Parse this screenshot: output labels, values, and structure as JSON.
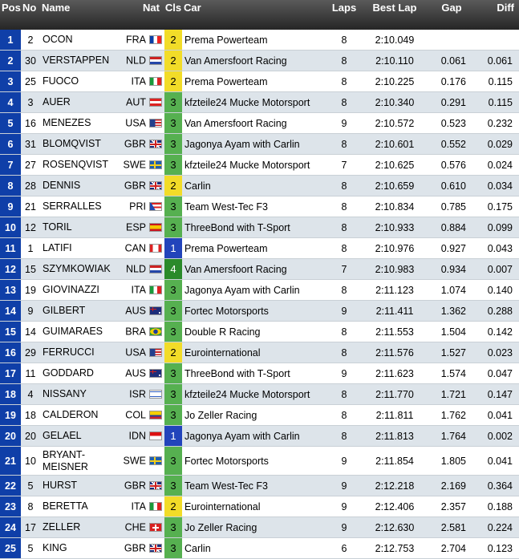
{
  "headers": {
    "pos": "Pos",
    "no": "No",
    "name": "Name",
    "nat": "Nat",
    "cls": "Cls",
    "car": "Car",
    "laps": "Laps",
    "best_lap": "Best Lap",
    "gap": "Gap",
    "diff": "Diff"
  },
  "class_colors": {
    "1": "#2244bb",
    "2": "#f2dc28",
    "3": "#56b050",
    "4": "#2a8a2a"
  },
  "rows": [
    {
      "pos": "1",
      "no": "2",
      "name": "OCON",
      "nat": "FRA",
      "flag": "flag-fra-icon",
      "cls": "2",
      "car": "Prema Powerteam",
      "laps": "8",
      "best": "2:10.049",
      "gap": "",
      "diff": ""
    },
    {
      "pos": "2",
      "no": "30",
      "name": "VERSTAPPEN",
      "nat": "NLD",
      "flag": "flag-nld-icon",
      "cls": "2",
      "car": "Van Amersfoort Racing",
      "laps": "8",
      "best": "2:10.110",
      "gap": "0.061",
      "diff": "0.061"
    },
    {
      "pos": "3",
      "no": "25",
      "name": "FUOCO",
      "nat": "ITA",
      "flag": "flag-ita-icon",
      "cls": "2",
      "car": "Prema Powerteam",
      "laps": "8",
      "best": "2:10.225",
      "gap": "0.176",
      "diff": "0.115"
    },
    {
      "pos": "4",
      "no": "3",
      "name": "AUER",
      "nat": "AUT",
      "flag": "flag-aut-icon",
      "cls": "3",
      "car": "kfzteile24 Mucke Motorsport",
      "laps": "8",
      "best": "2:10.340",
      "gap": "0.291",
      "diff": "0.115"
    },
    {
      "pos": "5",
      "no": "16",
      "name": "MENEZES",
      "nat": "USA",
      "flag": "flag-usa-icon",
      "cls": "3",
      "car": "Van Amersfoort Racing",
      "laps": "9",
      "best": "2:10.572",
      "gap": "0.523",
      "diff": "0.232"
    },
    {
      "pos": "6",
      "no": "31",
      "name": "BLOMQVIST",
      "nat": "GBR",
      "flag": "flag-gbr-icon",
      "cls": "3",
      "car": "Jagonya Ayam with Carlin",
      "laps": "8",
      "best": "2:10.601",
      "gap": "0.552",
      "diff": "0.029"
    },
    {
      "pos": "7",
      "no": "27",
      "name": "ROSENQVIST",
      "nat": "SWE",
      "flag": "flag-swe-icon",
      "cls": "3",
      "car": "kfzteile24 Mucke Motorsport",
      "laps": "7",
      "best": "2:10.625",
      "gap": "0.576",
      "diff": "0.024"
    },
    {
      "pos": "8",
      "no": "28",
      "name": "DENNIS",
      "nat": "GBR",
      "flag": "flag-gbr-icon",
      "cls": "2",
      "car": "Carlin",
      "laps": "8",
      "best": "2:10.659",
      "gap": "0.610",
      "diff": "0.034"
    },
    {
      "pos": "9",
      "no": "21",
      "name": "SERRALLES",
      "nat": "PRI",
      "flag": "flag-pri-icon",
      "cls": "3",
      "car": "Team West-Tec F3",
      "laps": "8",
      "best": "2:10.834",
      "gap": "0.785",
      "diff": "0.175"
    },
    {
      "pos": "10",
      "no": "12",
      "name": "TORIL",
      "nat": "ESP",
      "flag": "flag-esp-icon",
      "cls": "3",
      "car": "ThreeBond with T-Sport",
      "laps": "8",
      "best": "2:10.933",
      "gap": "0.884",
      "diff": "0.099"
    },
    {
      "pos": "11",
      "no": "1",
      "name": "LATIFI",
      "nat": "CAN",
      "flag": "flag-can-icon",
      "cls": "1",
      "car": "Prema Powerteam",
      "laps": "8",
      "best": "2:10.976",
      "gap": "0.927",
      "diff": "0.043"
    },
    {
      "pos": "12",
      "no": "15",
      "name": "SZYMKOWIAK",
      "nat": "NLD",
      "flag": "flag-nld-icon",
      "cls": "4",
      "car": "Van Amersfoort Racing",
      "laps": "7",
      "best": "2:10.983",
      "gap": "0.934",
      "diff": "0.007"
    },
    {
      "pos": "13",
      "no": "19",
      "name": "GIOVINAZZI",
      "nat": "ITA",
      "flag": "flag-ita-icon",
      "cls": "3",
      "car": "Jagonya Ayam with Carlin",
      "laps": "8",
      "best": "2:11.123",
      "gap": "1.074",
      "diff": "0.140"
    },
    {
      "pos": "14",
      "no": "9",
      "name": "GILBERT",
      "nat": "AUS",
      "flag": "flag-aus-icon",
      "cls": "3",
      "car": "Fortec Motorsports",
      "laps": "9",
      "best": "2:11.411",
      "gap": "1.362",
      "diff": "0.288"
    },
    {
      "pos": "15",
      "no": "14",
      "name": "GUIMARAES",
      "nat": "BRA",
      "flag": "flag-bra-icon",
      "cls": "3",
      "car": "Double R Racing",
      "laps": "8",
      "best": "2:11.553",
      "gap": "1.504",
      "diff": "0.142"
    },
    {
      "pos": "16",
      "no": "29",
      "name": "FERRUCCI",
      "nat": "USA",
      "flag": "flag-usa-icon",
      "cls": "2",
      "car": "Eurointernational",
      "laps": "8",
      "best": "2:11.576",
      "gap": "1.527",
      "diff": "0.023"
    },
    {
      "pos": "17",
      "no": "11",
      "name": "GODDARD",
      "nat": "AUS",
      "flag": "flag-aus-icon",
      "cls": "3",
      "car": "ThreeBond with T-Sport",
      "laps": "9",
      "best": "2:11.623",
      "gap": "1.574",
      "diff": "0.047"
    },
    {
      "pos": "18",
      "no": "4",
      "name": "NISSANY",
      "nat": "ISR",
      "flag": "flag-isr-icon",
      "cls": "3",
      "car": "kfzteile24 Mucke Motorsport",
      "laps": "8",
      "best": "2:11.770",
      "gap": "1.721",
      "diff": "0.147"
    },
    {
      "pos": "19",
      "no": "18",
      "name": "CALDERON",
      "nat": "COL",
      "flag": "flag-col-icon",
      "cls": "3",
      "car": "Jo Zeller Racing",
      "laps": "8",
      "best": "2:11.811",
      "gap": "1.762",
      "diff": "0.041"
    },
    {
      "pos": "20",
      "no": "20",
      "name": "GELAEL",
      "nat": "IDN",
      "flag": "flag-idn-icon",
      "cls": "1",
      "car": "Jagonya Ayam with Carlin",
      "laps": "8",
      "best": "2:11.813",
      "gap": "1.764",
      "diff": "0.002"
    },
    {
      "pos": "21",
      "no": "10",
      "name": "BRYANT-MEISNER",
      "nat": "SWE",
      "flag": "flag-swe-icon",
      "cls": "3",
      "car": "Fortec Motorsports",
      "laps": "9",
      "best": "2:11.854",
      "gap": "1.805",
      "diff": "0.041",
      "tall": true
    },
    {
      "pos": "22",
      "no": "5",
      "name": "HURST",
      "nat": "GBR",
      "flag": "flag-gbr-icon",
      "cls": "3",
      "car": "Team West-Tec F3",
      "laps": "9",
      "best": "2:12.218",
      "gap": "2.169",
      "diff": "0.364"
    },
    {
      "pos": "23",
      "no": "8",
      "name": "BERETTA",
      "nat": "ITA",
      "flag": "flag-ita-icon",
      "cls": "2",
      "car": "Eurointernational",
      "laps": "9",
      "best": "2:12.406",
      "gap": "2.357",
      "diff": "0.188"
    },
    {
      "pos": "24",
      "no": "17",
      "name": "ZELLER",
      "nat": "CHE",
      "flag": "flag-che-icon",
      "cls": "3",
      "car": "Jo Zeller Racing",
      "laps": "9",
      "best": "2:12.630",
      "gap": "2.581",
      "diff": "0.224"
    },
    {
      "pos": "25",
      "no": "5",
      "name": "KING",
      "nat": "GBR",
      "flag": "flag-gbr-icon",
      "cls": "3",
      "car": "Carlin",
      "laps": "6",
      "best": "2:12.753",
      "gap": "2.704",
      "diff": "0.123"
    }
  ]
}
